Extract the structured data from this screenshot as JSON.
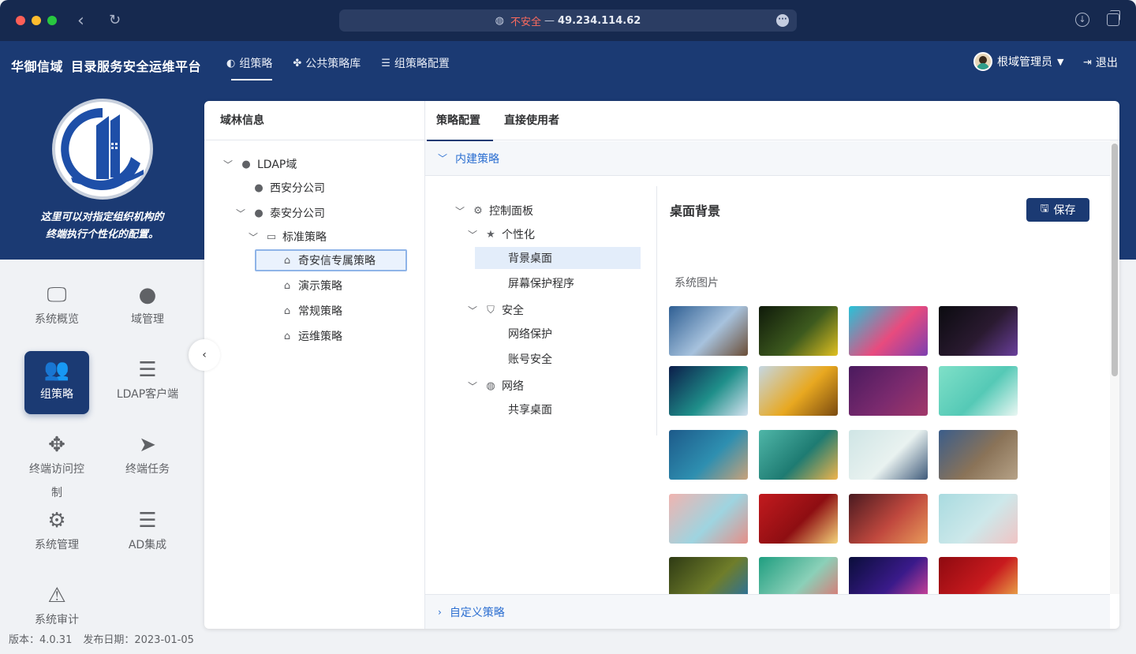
{
  "browser": {
    "insecure_label": "不安全",
    "separator": "—",
    "address": "49.234.114.62"
  },
  "header": {
    "brand_name": "华御信域",
    "brand_title": "目录服务安全运维平台",
    "nav": [
      {
        "label": "组策略",
        "icon": "palette-icon",
        "active": true
      },
      {
        "label": "公共策略库",
        "icon": "cubes-icon",
        "active": false
      },
      {
        "label": "组策略配置",
        "icon": "server-icon",
        "active": false
      }
    ],
    "user_name": "根域管理员",
    "logout_label": "退出"
  },
  "sidebar": {
    "hero_line1": "这里可以对指定组织机构的",
    "hero_line2": "终端执行个性化的配置。",
    "menu": [
      {
        "label": "系统概览",
        "icon": "monitor-icon"
      },
      {
        "label": "域管理",
        "icon": "globe-icon"
      },
      {
        "label": "组策略",
        "icon": "users-icon",
        "active": true
      },
      {
        "label": "LDAP客户端",
        "icon": "list-icon"
      },
      {
        "label": "终端访问控",
        "label2": "制",
        "icon": "move-icon"
      },
      {
        "label": "终端任务",
        "icon": "paper-plane-icon"
      },
      {
        "label": "系统管理",
        "icon": "gear-icon"
      },
      {
        "label": "AD集成",
        "icon": "server-icon"
      },
      {
        "label": "系统审计",
        "icon": "warning-icon"
      }
    ],
    "version_label": "版本：4.0.31",
    "date_label": "发布日期：2023-01-05"
  },
  "forest": {
    "title": "域林信息",
    "nodes": [
      {
        "label": "LDAP域",
        "icon": "globe-icon"
      },
      {
        "label": "西安分公司",
        "icon": "globe-icon"
      },
      {
        "label": "泰安分公司",
        "icon": "globe-icon"
      },
      {
        "label": "标准策略",
        "icon": "folder-icon"
      },
      {
        "label": "奇安信专属策略",
        "icon": "tag-icon",
        "selected": true
      },
      {
        "label": "演示策略",
        "icon": "tag-icon"
      },
      {
        "label": "常规策略",
        "icon": "tag-icon"
      },
      {
        "label": "运维策略",
        "icon": "tag-icon"
      }
    ]
  },
  "main": {
    "tabs": [
      {
        "label": "策略配置",
        "active": true
      },
      {
        "label": "直接使用者",
        "active": false
      }
    ],
    "builtin_section": "内建策略",
    "custom_section": "自定义策略",
    "policy_tree": [
      {
        "label": "控制面板",
        "icon": "gear-icon"
      },
      {
        "label": "个性化",
        "icon": "star-icon"
      },
      {
        "label": "背景桌面",
        "selected": true
      },
      {
        "label": "屏幕保护程序"
      },
      {
        "label": "安全",
        "icon": "shield-icon"
      },
      {
        "label": "网络保护"
      },
      {
        "label": "账号安全"
      },
      {
        "label": "网络",
        "icon": "globe-icon"
      },
      {
        "label": "共享桌面"
      }
    ],
    "detail_title": "桌面背景",
    "save_label": "保存",
    "system_images_label": "系统图片",
    "wallpapers": [
      {
        "name": "mountain-wallpaper",
        "colors": [
          "#2f5f93",
          "#a7c2dd",
          "#6b4d36"
        ]
      },
      {
        "name": "yellow-flowers-wallpaper",
        "colors": [
          "#0f1a0a",
          "#3d5a1e",
          "#e0c020"
        ]
      },
      {
        "name": "ribbon-wallpaper",
        "colors": [
          "#27c3d8",
          "#e84b7e",
          "#7d3fb0"
        ]
      },
      {
        "name": "horse-wallpaper",
        "colors": [
          "#0b0b10",
          "#2a1a30",
          "#6a3f9c"
        ]
      },
      {
        "name": "aurora-wallpaper",
        "colors": [
          "#0c1d4a",
          "#1f8f8a",
          "#d6e3f0"
        ]
      },
      {
        "name": "sunflower-wallpaper",
        "colors": [
          "#c5d7e3",
          "#e8a820",
          "#7a4a10"
        ]
      },
      {
        "name": "purple-gradient-wallpaper",
        "colors": [
          "#4a1a5e",
          "#7a2a6e",
          "#a2386a"
        ]
      },
      {
        "name": "mint-wallpaper",
        "colors": [
          "#7fe0c8",
          "#55c9b6",
          "#eaf7f3"
        ]
      },
      {
        "name": "coast-wallpaper",
        "colors": [
          "#1d5a8a",
          "#2e8fb0",
          "#c9a27a"
        ]
      },
      {
        "name": "teal-dune-wallpaper",
        "colors": [
          "#4fb6a8",
          "#1e7b72",
          "#f0b44c"
        ]
      },
      {
        "name": "building-wallpaper",
        "colors": [
          "#cfe5e5",
          "#e9f2f0",
          "#3f5a7a"
        ]
      },
      {
        "name": "desert-lake-wallpaper",
        "colors": [
          "#3b5d8a",
          "#8a7358",
          "#b6a287"
        ]
      },
      {
        "name": "pink-architecture-wallpaper",
        "colors": [
          "#f0b4b0",
          "#9ed4e0",
          "#e58f88"
        ]
      },
      {
        "name": "red-celebration-wallpaper",
        "colors": [
          "#c21a1e",
          "#8e0e12",
          "#f4d37a"
        ]
      },
      {
        "name": "canyon-wallpaper",
        "colors": [
          "#4a1a20",
          "#c0483e",
          "#e89a5a"
        ]
      },
      {
        "name": "flamingo-wallpaper",
        "colors": [
          "#a9dbe0",
          "#cde8ea",
          "#f0c4c4"
        ]
      },
      {
        "name": "kingfisher-wallpaper",
        "colors": [
          "#2e3a14",
          "#6f7d2a",
          "#1e6fb0"
        ]
      },
      {
        "name": "green-shape-wallpaper",
        "colors": [
          "#1f9e80",
          "#8bd0b8",
          "#e86a6a"
        ]
      },
      {
        "name": "festival-lights-wallpaper",
        "colors": [
          "#0a0e3a",
          "#3a1a8a",
          "#e84a9a"
        ]
      },
      {
        "name": "red-new-year-wallpaper",
        "colors": [
          "#8e0a10",
          "#c81a1e",
          "#f0c050"
        ]
      }
    ]
  }
}
